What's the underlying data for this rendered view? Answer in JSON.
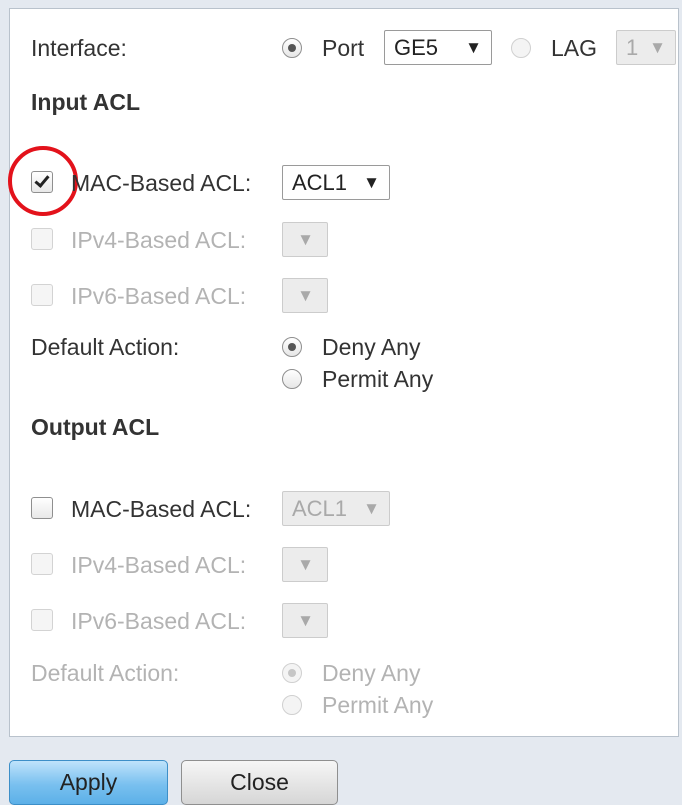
{
  "interface": {
    "label": "Interface:",
    "port_label": "Port",
    "port_value": "GE5",
    "lag_label": "LAG",
    "lag_value": "1"
  },
  "input_acl": {
    "heading": "Input ACL",
    "mac_label": "MAC-Based ACL:",
    "mac_checked": true,
    "mac_value": "ACL1",
    "ipv4_label": "IPv4-Based ACL:",
    "ipv6_label": "IPv6-Based ACL:",
    "default_action_label": "Default Action:",
    "deny_any": "Deny Any",
    "permit_any": "Permit Any"
  },
  "output_acl": {
    "heading": "Output ACL",
    "mac_label": "MAC-Based ACL:",
    "mac_checked": false,
    "mac_value": "ACL1",
    "ipv4_label": "IPv4-Based ACL:",
    "ipv6_label": "IPv6-Based ACL:",
    "default_action_label": "Default Action:",
    "deny_any": "Deny Any",
    "permit_any": "Permit Any"
  },
  "buttons": {
    "apply": "Apply",
    "close": "Close"
  },
  "icons": {
    "dropdown_arrow": "▼",
    "checkmark": "check-icon"
  },
  "colors": {
    "highlight_ring": "#e3121b",
    "apply_button": "#79c0ef"
  }
}
